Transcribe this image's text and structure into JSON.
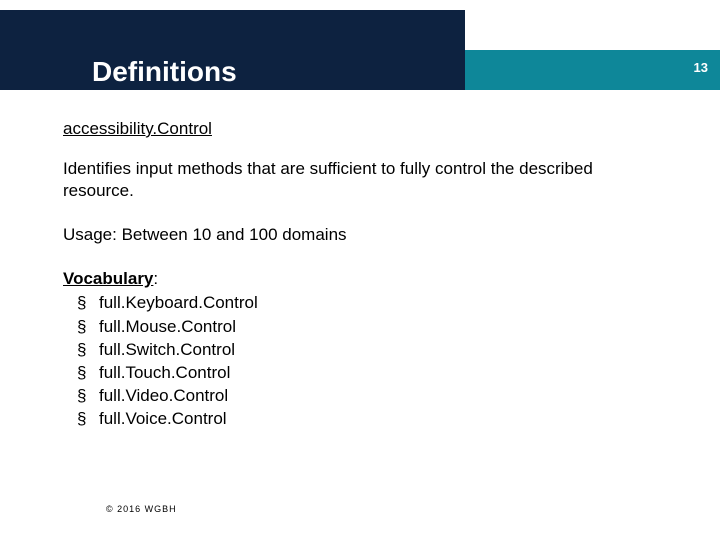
{
  "header": {
    "title": "Definitions",
    "page_number": "13"
  },
  "content": {
    "term": "accessibility.Control",
    "description": "Identifies input methods that are sufficient to fully control the described resource.",
    "usage": "Usage: Between 10 and 100 domains",
    "vocab_label": "Vocabulary",
    "vocab_items": [
      "full.Keyboard.Control",
      "full.Mouse.Control",
      "full.Switch.Control",
      "full.Touch.Control",
      "full.Video.Control",
      "full.Voice.Control"
    ]
  },
  "footer": {
    "copyright": "© 2016 WGBH"
  }
}
